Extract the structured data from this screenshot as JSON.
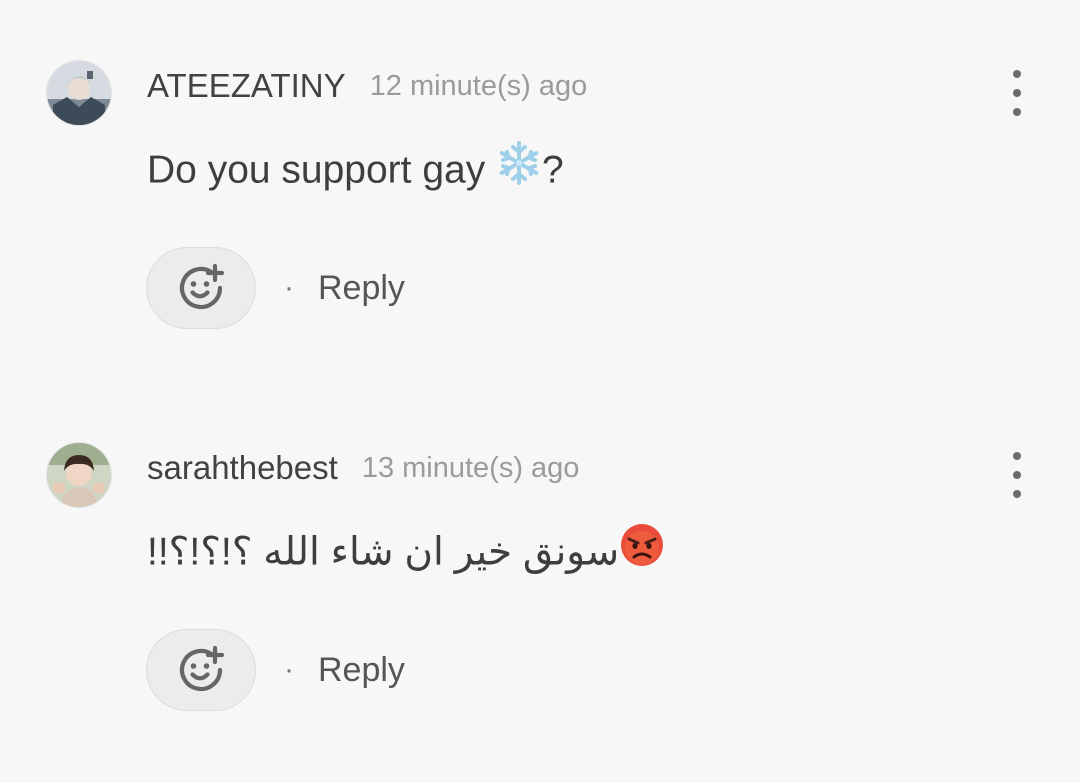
{
  "comments": [
    {
      "username": "ATEEZATINY",
      "time": "12 minute(s) ago",
      "text": "Do you support gay ",
      "text_suffix": "?",
      "emoji": "snowflake",
      "reply_label": "Reply",
      "separator": "·"
    },
    {
      "username": "sarahthebest",
      "time": "13 minute(s) ago",
      "text": "سونق خير ان شاء الله ؟!؟!؟!!",
      "emoji": "angry-face",
      "reply_label": "Reply",
      "separator": "·"
    }
  ],
  "colors": {
    "background": "#f7f7f7",
    "username": "#424242",
    "timestamp": "#9b9b9b",
    "icon": "#6b6b6b",
    "button_bg": "#ececec"
  }
}
